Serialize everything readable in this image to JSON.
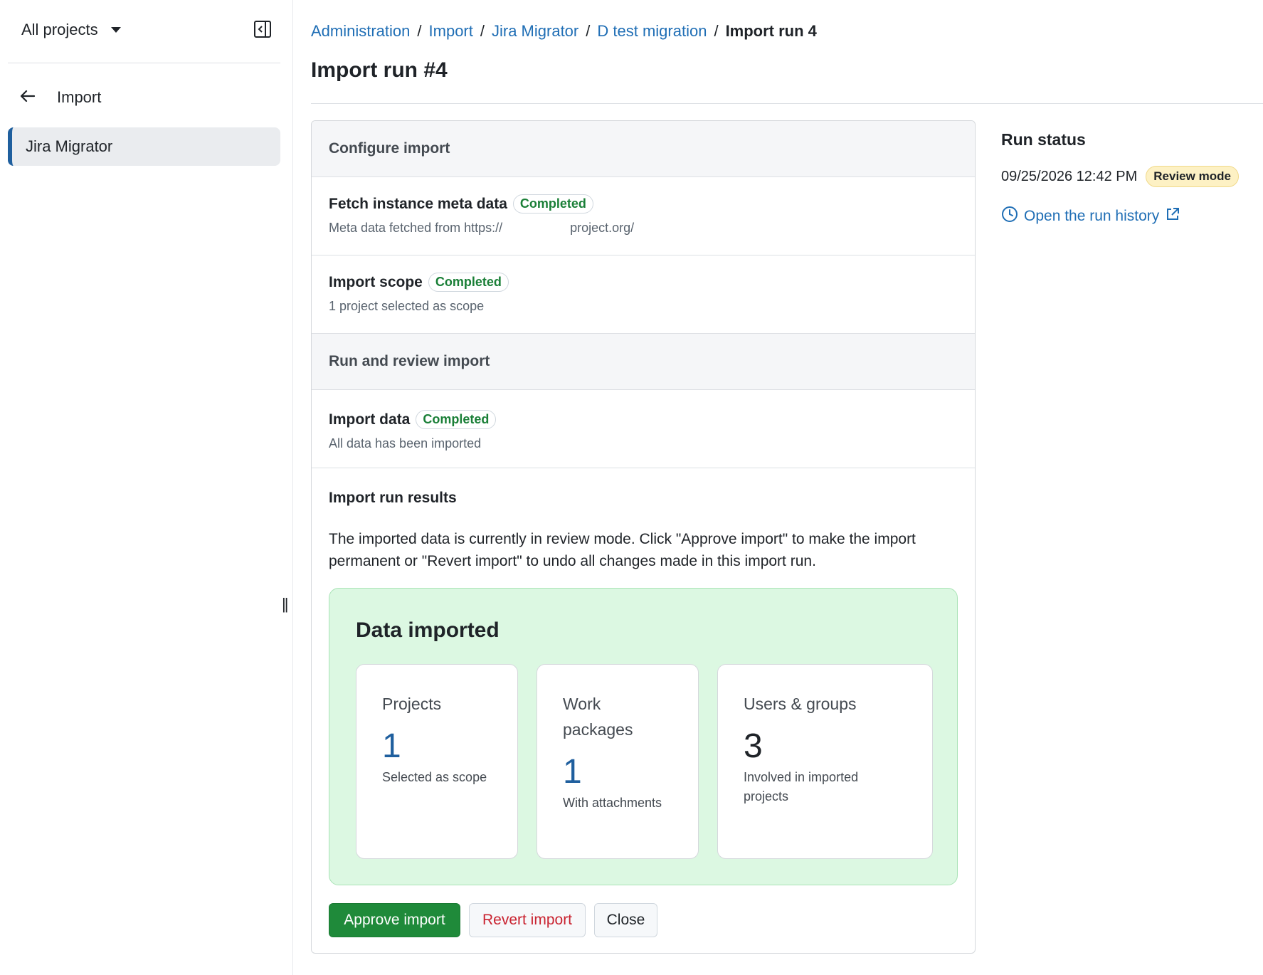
{
  "sidebar": {
    "project_selector": "All projects",
    "back_label": "Import",
    "active_item": "Jira Migrator",
    "resize_glyph": "||"
  },
  "breadcrumb": {
    "items": [
      "Administration",
      "Import",
      "Jira Migrator",
      "D test migration"
    ],
    "separator": "/",
    "current": "Import run 4"
  },
  "page": {
    "title": "Import run #4"
  },
  "configure": {
    "heading": "Configure import",
    "steps": [
      {
        "title": "Fetch instance meta data",
        "status": "Completed",
        "desc_prefix": "Meta data fetched from https://",
        "desc_suffix": "project.org/"
      },
      {
        "title": "Import scope",
        "status": "Completed",
        "desc": "1 project selected as scope"
      }
    ]
  },
  "run_review": {
    "heading": "Run and review import",
    "step": {
      "title": "Import data",
      "status": "Completed",
      "desc": "All data has been imported"
    }
  },
  "results": {
    "title": "Import run results",
    "text": "The imported data is currently in review mode. Click \"Approve import\" to make the import permanent or \"Revert import\" to undo all changes made in this import run.",
    "box_title": "Data imported",
    "cards": [
      {
        "label": "Projects",
        "value": "1",
        "desc": "Selected as scope"
      },
      {
        "label": "Work packages",
        "value": "1",
        "desc": "With attachments"
      },
      {
        "label": "Users & groups",
        "value": "3",
        "desc": "Involved in imported projects"
      }
    ]
  },
  "actions": {
    "approve": "Approve import",
    "revert": "Revert import",
    "close": "Close"
  },
  "run_status": {
    "title": "Run status",
    "datetime": "09/25/2026 12:42 PM",
    "mode_badge": "Review mode",
    "history_link": "Open the run history"
  },
  "colors": {
    "link": "#1f6eb5",
    "success": "#1a7f37",
    "approve_button": "#1f8a3a",
    "revert_text": "#c9222f",
    "data_box_bg": "#dcf8e2",
    "review_badge_bg": "#fdf1c4",
    "active_nav_accent": "#1f5f9e"
  },
  "icons": [
    "caret-down-icon",
    "collapse-sidebar-icon",
    "arrow-left-icon",
    "clock-icon",
    "external-link-icon",
    "resize-handle-icon"
  ]
}
